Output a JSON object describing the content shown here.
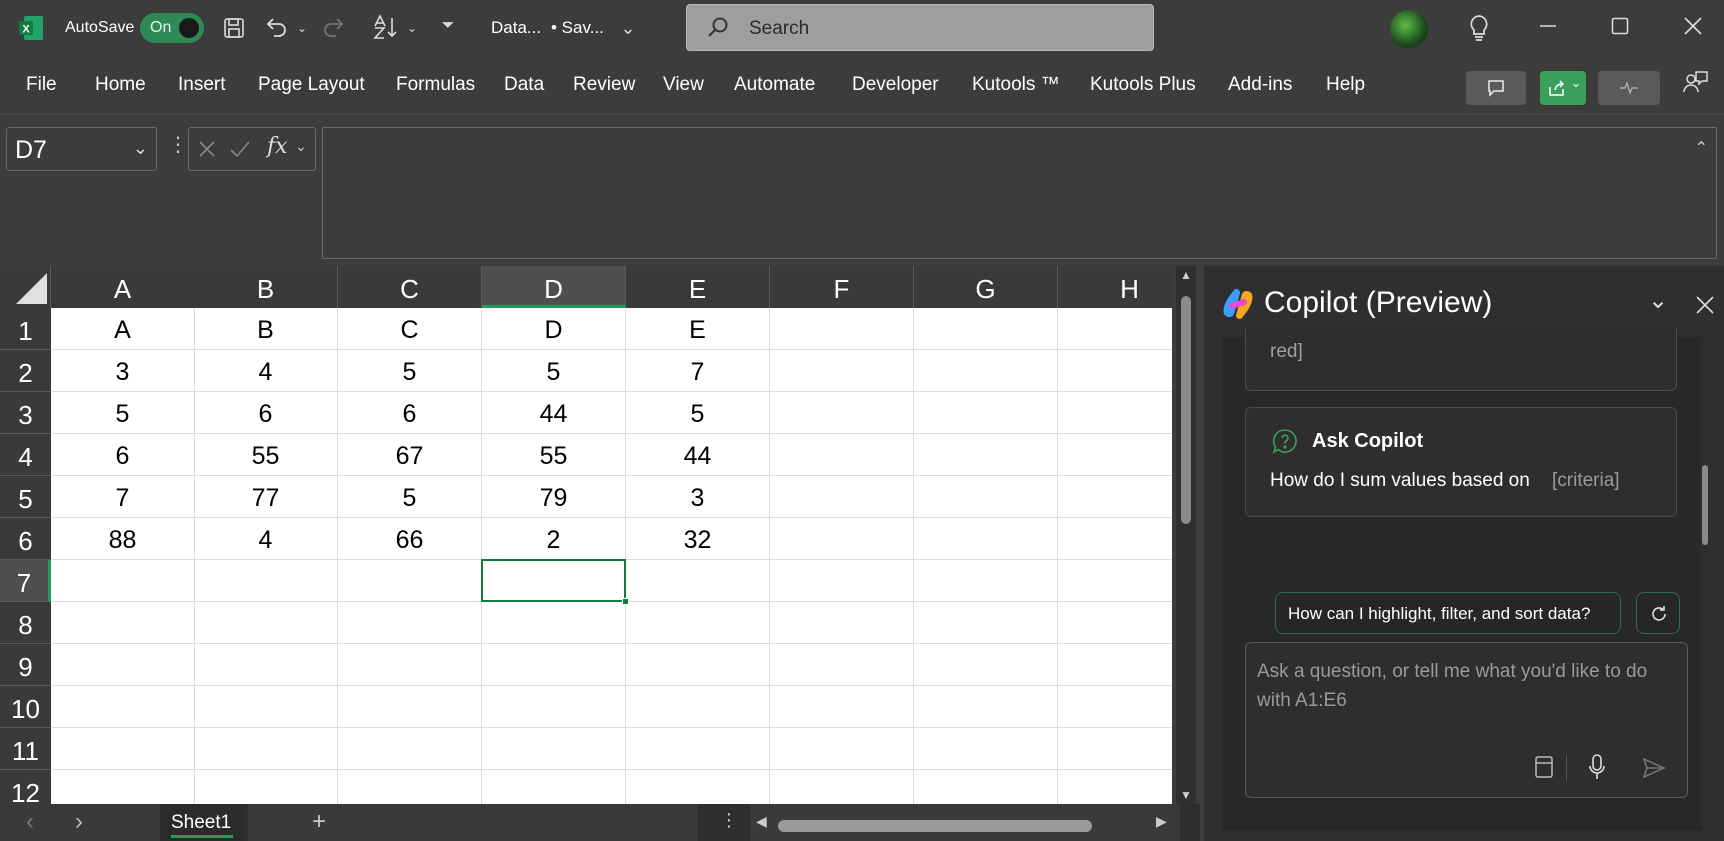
{
  "titlebar": {
    "autosave_label": "AutoSave",
    "toggle_label": "On",
    "doc_title": "Data...",
    "save_state": "• Sav...",
    "search_placeholder": "Search"
  },
  "ribbon": {
    "tabs": [
      "File",
      "Home",
      "Insert",
      "Page Layout",
      "Formulas",
      "Data",
      "Review",
      "View",
      "Automate",
      "Developer",
      "Kutools ™",
      "Kutools Plus",
      "Add-ins",
      "Help"
    ]
  },
  "formula_bar": {
    "name_box": "D7",
    "fx": "fx",
    "formula": ""
  },
  "grid": {
    "columns": [
      "A",
      "B",
      "C",
      "D",
      "E",
      "F",
      "G",
      "H"
    ],
    "rows": [
      "1",
      "2",
      "3",
      "4",
      "5",
      "6",
      "7",
      "8",
      "9",
      "10",
      "11",
      "12"
    ],
    "active_col": "D",
    "active_row": "7",
    "cells": [
      [
        "A",
        "B",
        "C",
        "D",
        "E"
      ],
      [
        "3",
        "4",
        "5",
        "5",
        "7"
      ],
      [
        "5",
        "6",
        "6",
        "44",
        "5"
      ],
      [
        "6",
        "55",
        "67",
        "55",
        "44"
      ],
      [
        "7",
        "77",
        "5",
        "79",
        "3"
      ],
      [
        "88",
        "4",
        "66",
        "2",
        "32"
      ]
    ]
  },
  "sheets": {
    "active": "Sheet1"
  },
  "copilot": {
    "title": "Copilot (Preview)",
    "truncated_text": "red]",
    "card_title": "Ask Copilot",
    "card_prompt": "How do I sum values based on",
    "card_placeholder": "[criteria]",
    "suggestion": "How can I highlight, filter, and sort data?",
    "input_placeholder": "Ask a question, or tell me what you'd like to do with A1:E6"
  },
  "colors": {
    "excel_green": "#107c41",
    "toggle_green": "#2e8a55",
    "share_green": "#3aa05c"
  }
}
